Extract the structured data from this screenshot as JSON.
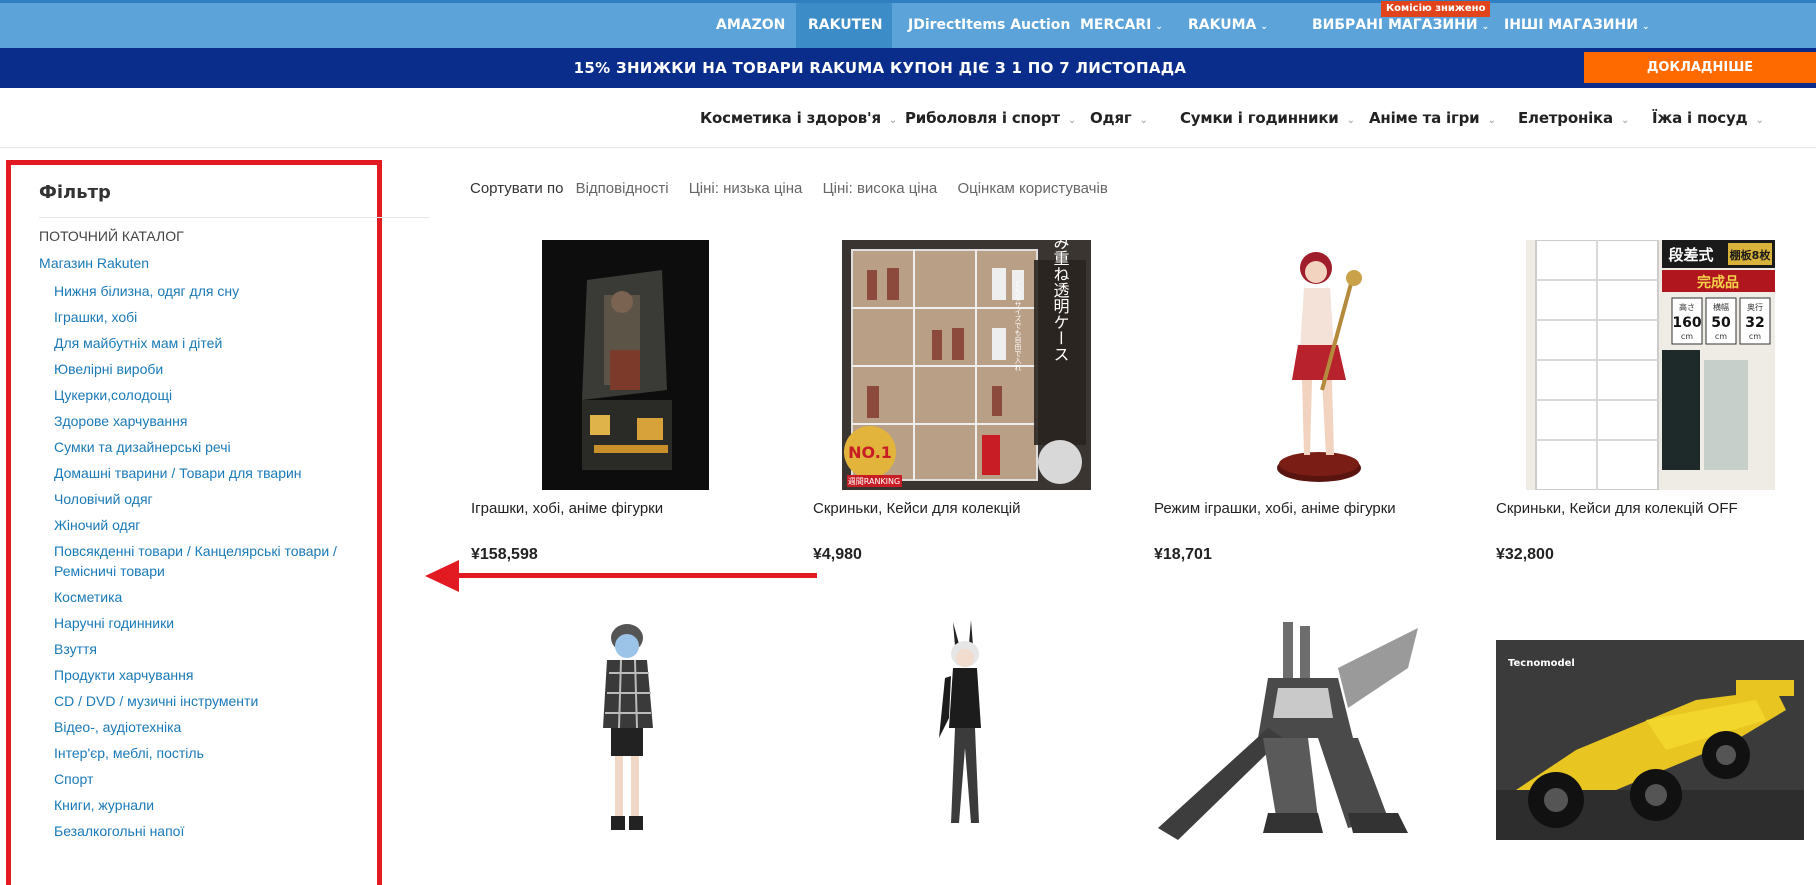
{
  "topnav": {
    "items": [
      {
        "label": "AMAZON"
      },
      {
        "label": "RAKUTEN"
      },
      {
        "label": "JDirectItems Auction"
      },
      {
        "label": "MERCARI"
      },
      {
        "label": "RAKUMA"
      },
      {
        "label": "ВИБРАНІ МАГАЗИНИ"
      },
      {
        "label": "ІНШІ МАГАЗИНИ"
      }
    ],
    "badge": "Комісію знижено",
    "colors": {
      "bar": "#5ba3d8",
      "active": "#3c8cc7"
    }
  },
  "promo": {
    "text": "15% ЗНИЖКИ НА ТОВАРИ RAKUMA КУПОН ДІЄ З 1 ПО 7 ЛИСТОПАДА",
    "button": "ДОКЛАДНІШЕ",
    "colors": {
      "bar": "#0a2c8a",
      "button": "#ff6a00"
    }
  },
  "categories": [
    {
      "label": "Косметика і здоров'я"
    },
    {
      "label": "Риболовля і спорт"
    },
    {
      "label": "Одяг"
    },
    {
      "label": "Сумки і годинники"
    },
    {
      "label": "Аніме та ігри"
    },
    {
      "label": "Елетроніка"
    },
    {
      "label": "Їжа і посуд"
    }
  ],
  "filter": {
    "title": "Фільтр",
    "section": "ПОТОЧНИЙ КАТАЛОГ",
    "root": "Магазин Rakuten",
    "items": [
      "Нижня білизна, одяг для сну",
      "Іграшки, хобі",
      "Для майбутніх мам і дітей",
      "Ювелірні вироби",
      "Цукерки,солодощі",
      "Здорове харчування",
      "Сумки та дизайнерські речі",
      "Домашні тварини / Товари для тварин",
      "Чоловічий одяг",
      "Жіночий одяг",
      "Повсякденні товари / Канцелярські товари / Ремісничі товари",
      "Косметика",
      "Наручні годинники",
      "Взуття",
      "Продукти харчування",
      "CD / DVD / музичні інструменти",
      "Відео-, аудіотехніка",
      "Інтер'єр, меблі, постіль",
      "Спорт",
      "Книги, журнали",
      "Безалкогольні напої"
    ]
  },
  "sort": {
    "label": "Сортувати по",
    "options": [
      "Відповідності",
      "Ціні: низька ціна",
      "Ціні: висока ціна",
      "Оцінкам користувачів"
    ]
  },
  "products": [
    {
      "title": "Іграшки, хобі, аніме фігурки",
      "price": "¥158,598"
    },
    {
      "title": "Скриньки, Кейси для колекцій",
      "price": "¥4,980"
    },
    {
      "title": "Режим іграшки, хобі, аніме фігурки",
      "price": "¥18,701"
    },
    {
      "title": "Скриньки, Кейси для колекцій OFF",
      "price": "¥32,800"
    },
    {
      "title": "",
      "price": ""
    },
    {
      "title": "",
      "price": ""
    },
    {
      "title": "",
      "price": ""
    },
    {
      "title": "",
      "price": ""
    }
  ],
  "product_images": {
    "p1_text": [],
    "p2_badge": "NO.1",
    "p2_sub": "週間RANKING",
    "p2_vertical": "積み重ね透明ケース",
    "p2_side": "どんなサイズでも自由で入れ",
    "p4_top": "段差式",
    "p4_count": "棚板8枚",
    "p4_done": "完成品",
    "p4_dims": [
      {
        "label": "高さ",
        "value": "160",
        "unit": "cm"
      },
      {
        "label": "横幅",
        "value": "50",
        "unit": "cm"
      },
      {
        "label": "奥行",
        "value": "32",
        "unit": "cm"
      }
    ],
    "p8_brand": "Tecnomodel"
  }
}
